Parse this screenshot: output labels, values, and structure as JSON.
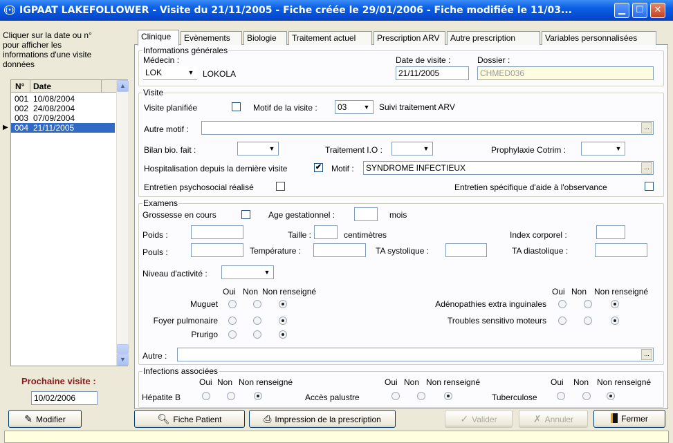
{
  "window": {
    "title": "IGPAAT LAKEFOLLOWER - Visite du 21/11/2005 - Fiche créée le 29/01/2006 - Fiche modifiée le 11/03...",
    "icon_text": "(•)"
  },
  "left": {
    "instruction": [
      "Cliquer sur la date ou n°",
      "pour afficher les",
      "informations d'une visite",
      "données"
    ],
    "columns": {
      "num": "N°",
      "date": "Date"
    },
    "visits": [
      {
        "num": "001",
        "date": "10/08/2004"
      },
      {
        "num": "002",
        "date": "24/08/2004"
      },
      {
        "num": "003",
        "date": "07/09/2004"
      },
      {
        "num": "004",
        "date": "21/11/2005"
      }
    ],
    "selected_index": 3,
    "next_visit_label": "Prochaine visite :",
    "next_visit_value": "10/02/2006"
  },
  "tabs": [
    "Clinique",
    "Evènements",
    "Biologie",
    "Traitement actuel",
    "Prescription ARV",
    "Autre prescription",
    "Variables personnalisées"
  ],
  "active_tab": "Clinique",
  "general": {
    "title": "Informations générales",
    "medecin_label": "Médecin :",
    "medecin_code": "LOK",
    "medecin_name": "LOKOLA",
    "date_label": "Date de visite :",
    "date_value": "21/11/2005",
    "dossier_label": "Dossier :",
    "dossier_value": "CHMED036"
  },
  "visite": {
    "title": "Visite",
    "planifiee_label": "Visite planifiée",
    "planifiee_checked": false,
    "motif_label": "Motif de la visite :",
    "motif_code": "03",
    "motif_text": "Suivi traitement ARV",
    "autre_motif_label": "Autre motif :",
    "autre_motif_value": "",
    "bilan_label": "Bilan bio. fait :",
    "traitement_io_label": "Traitement I.O :",
    "prophylaxie_label": "Prophylaxie Cotrim :",
    "hosp_label": "Hospitalisation depuis la dernière visite",
    "hosp_checked": true,
    "hosp_motif_label": "Motif :",
    "hosp_motif_value": "SYNDROME INFECTIEUX",
    "entretien_label": "Entretien psychosocial réalisé",
    "entretien_obs_label": "Entretien spécifique d'aide à l'observance",
    "check_mark": "✔",
    "ellipsis": "..."
  },
  "examens": {
    "title": "Examens",
    "grossesse_label": "Grossesse en cours",
    "age_gest_label": "Age gestationnel :",
    "mois_label": "mois",
    "poids_label": "Poids :",
    "taille_label": "Taille :",
    "centimetres_label": "centimètres",
    "index_label": "Index corporel :",
    "pouls_label": "Pouls :",
    "temperature_label": "Température :",
    "ta_sys_label": "TA systolique :",
    "ta_dia_label": "TA diastolique :",
    "niveau_label": "Niveau d'activité :",
    "radio_headers": {
      "oui": "Oui",
      "non": "Non",
      "nr": "Non renseigné"
    },
    "left_items": [
      {
        "label": "Muguet",
        "value": "nr"
      },
      {
        "label": "Foyer pulmonaire",
        "value": "nr"
      },
      {
        "label": "Prurigo",
        "value": "nr"
      }
    ],
    "right_items": [
      {
        "label": "Adénopathies extra inguinales",
        "value": "nr"
      },
      {
        "label": "Troubles sensitivo moteurs",
        "value": "nr"
      }
    ],
    "autre_label": "Autre :"
  },
  "infections": {
    "title": "Infections associées",
    "items": [
      {
        "label": "Hépatite B",
        "value": "nr"
      },
      {
        "label": "Accès palustre",
        "value": "nr"
      },
      {
        "label": "Tuberculose",
        "value": "nr"
      }
    ]
  },
  "toolbar": {
    "modifier": "Modifier",
    "fiche_patient": "Fiche Patient",
    "impression": "Impression de la prescription",
    "valider": "Valider",
    "annuler": "Annuler",
    "fermer": "Fermer"
  }
}
